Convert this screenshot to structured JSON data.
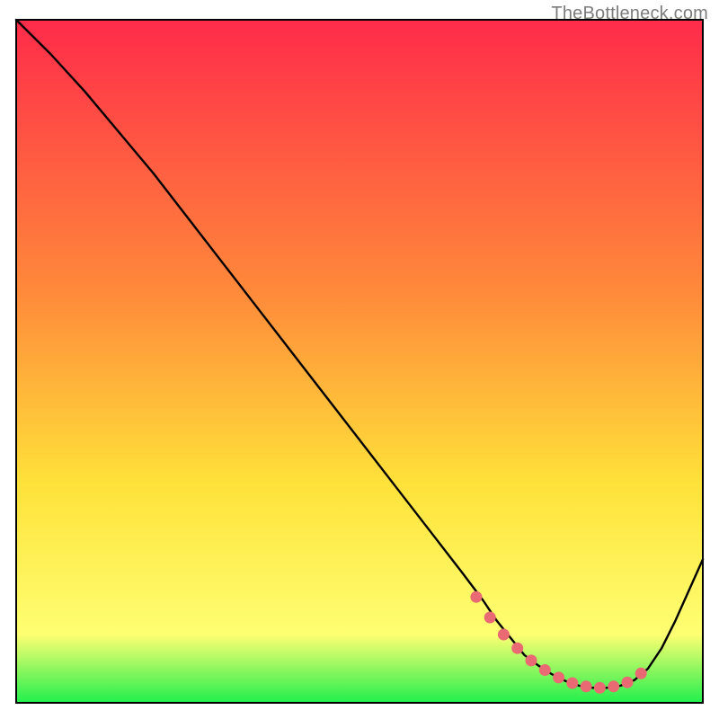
{
  "watermark": "TheBottleneck.com",
  "colors": {
    "gradient_top": "#ff2b4a",
    "gradient_mid1": "#ff8a3a",
    "gradient_mid2": "#ffe23a",
    "gradient_mid3": "#feff72",
    "gradient_bottom": "#21ef4d",
    "curve": "#000000",
    "markers": "#ea6a73",
    "frame": "#000000"
  },
  "chart_data": {
    "type": "line",
    "title": "",
    "xlabel": "",
    "ylabel": "",
    "xlim": [
      0,
      100
    ],
    "ylim": [
      0,
      100
    ],
    "grid": false,
    "legend": false,
    "series": [
      {
        "name": "bottleneck-curve",
        "x": [
          0,
          5,
          10,
          15,
          20,
          25,
          30,
          35,
          40,
          45,
          50,
          55,
          60,
          65,
          68,
          70,
          72,
          74,
          76,
          78,
          80,
          82,
          84,
          86,
          88,
          90,
          92,
          94,
          96,
          100
        ],
        "y": [
          100,
          95,
          89.5,
          83.5,
          77.5,
          71,
          64.5,
          58,
          51.5,
          45,
          38.5,
          32,
          25.5,
          19,
          15,
          12,
          9.5,
          7,
          5.5,
          4.2,
          3.2,
          2.5,
          2.2,
          2.2,
          2.5,
          3.3,
          5,
          8,
          12,
          21
        ]
      }
    ],
    "markers": {
      "name": "highlight-dots",
      "x": [
        67,
        69,
        71,
        73,
        75,
        77,
        79,
        81,
        83,
        85,
        87,
        89,
        91
      ],
      "y": [
        15.5,
        12.5,
        10,
        8,
        6.2,
        4.8,
        3.7,
        2.9,
        2.4,
        2.2,
        2.4,
        3.0,
        4.3
      ]
    }
  }
}
